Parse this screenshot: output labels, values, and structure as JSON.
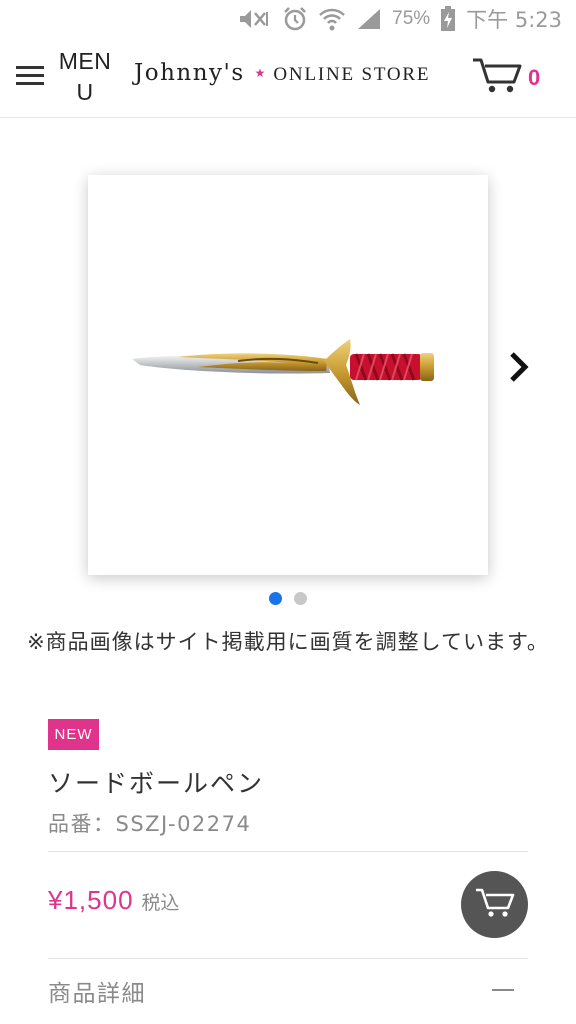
{
  "status_bar": {
    "battery": "75%",
    "time": "下午 5:23",
    "icons": [
      "mute-icon",
      "alarm-icon",
      "wifi-icon",
      "signal-icon",
      "battery-charging-icon"
    ]
  },
  "header": {
    "menu_label": "MENU",
    "logo_main": "Johnny's",
    "logo_star": "★",
    "logo_sub": "ONLINE STORE",
    "cart_count": "0",
    "brand_color": "#e0338b"
  },
  "gallery": {
    "image_alt": "sword-pen-image",
    "slide_count": 2,
    "active_slide": 1,
    "notice": "※商品画像はサイト掲載用に画質を調整しています。"
  },
  "product": {
    "badge": "NEW",
    "name": "ソードボールペン",
    "code": "品番：SSZJ-02274",
    "price": "¥1,500",
    "tax_label": "税込",
    "details_label": "商品詳細"
  }
}
